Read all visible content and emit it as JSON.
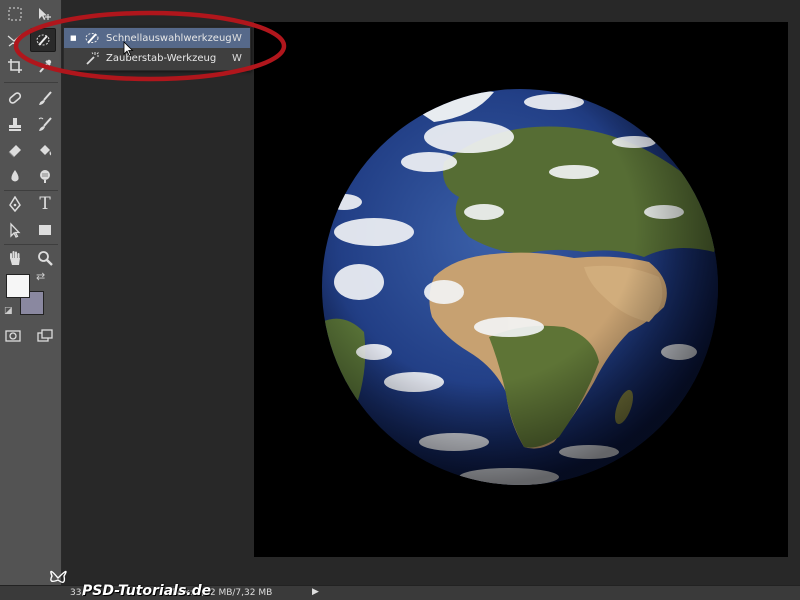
{
  "toolbar": {
    "tools": [
      {
        "name": "marquee-tool-icon"
      },
      {
        "name": "move-tool-icon"
      },
      {
        "name": "lasso-tool-icon"
      },
      {
        "name": "quick-selection-tool-icon"
      },
      {
        "name": "crop-tool-icon"
      },
      {
        "name": "eyedropper-tool-icon"
      },
      {
        "name": "healing-brush-tool-icon"
      },
      {
        "name": "brush-tool-icon"
      },
      {
        "name": "clone-stamp-tool-icon"
      },
      {
        "name": "history-brush-tool-icon"
      },
      {
        "name": "eraser-tool-icon"
      },
      {
        "name": "paint-bucket-tool-icon"
      },
      {
        "name": "blur-tool-icon"
      },
      {
        "name": "dodge-tool-icon"
      },
      {
        "name": "pen-tool-icon"
      },
      {
        "name": "type-tool-icon"
      },
      {
        "name": "path-selection-tool-icon"
      },
      {
        "name": "rectangle-tool-icon"
      },
      {
        "name": "hand-tool-icon"
      },
      {
        "name": "zoom-tool-icon"
      },
      {
        "name": "quick-mask-icon"
      },
      {
        "name": "screen-mode-icon"
      }
    ],
    "type_glyph": "T",
    "foreground_color": "#f6f6f6",
    "background_color": "#8a88a0"
  },
  "flyout": {
    "items": [
      {
        "label": "Schnellauswahlwerkzeug",
        "shortcut": "W",
        "selected": true,
        "icon": "quick-selection-icon"
      },
      {
        "label": "Zauberstab-Werkzeug",
        "shortcut": "W",
        "selected": false,
        "icon": "magic-wand-icon"
      }
    ],
    "selected_marker": "■",
    "highlight_color": "#b0161c"
  },
  "canvas": {
    "background": "#000000",
    "image": "earth-globe"
  },
  "statusbar": {
    "zoom": "33,",
    "doc_info": "Dok: 7,32 MB/7,32 MB",
    "arrow": "▶"
  },
  "watermark": {
    "text": "PSD-Tutorials.de"
  }
}
